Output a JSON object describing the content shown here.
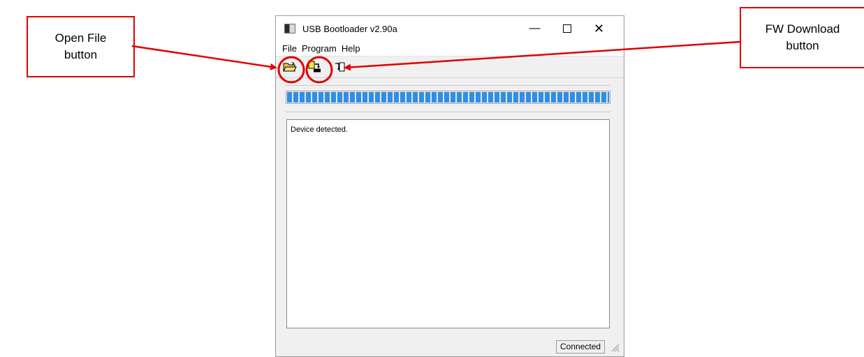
{
  "callouts": {
    "open_file": [
      "Open File",
      "button"
    ],
    "fw_download": [
      "FW Download",
      "button"
    ]
  },
  "window": {
    "title": "USB Bootloader v2.90a",
    "controls": {
      "minimize": "—",
      "close": "✕"
    }
  },
  "menu": [
    "File",
    "Program",
    "Help"
  ],
  "toolbar": {
    "buttons": [
      "open-file-icon",
      "fw-download-icon",
      "reset-icon"
    ]
  },
  "progress": {
    "value": 1.0,
    "color": "#2f8fe6"
  },
  "log": {
    "lines": [
      "Device detected."
    ]
  },
  "status": {
    "connection": "Connected"
  },
  "annotation_color": "#e00000"
}
